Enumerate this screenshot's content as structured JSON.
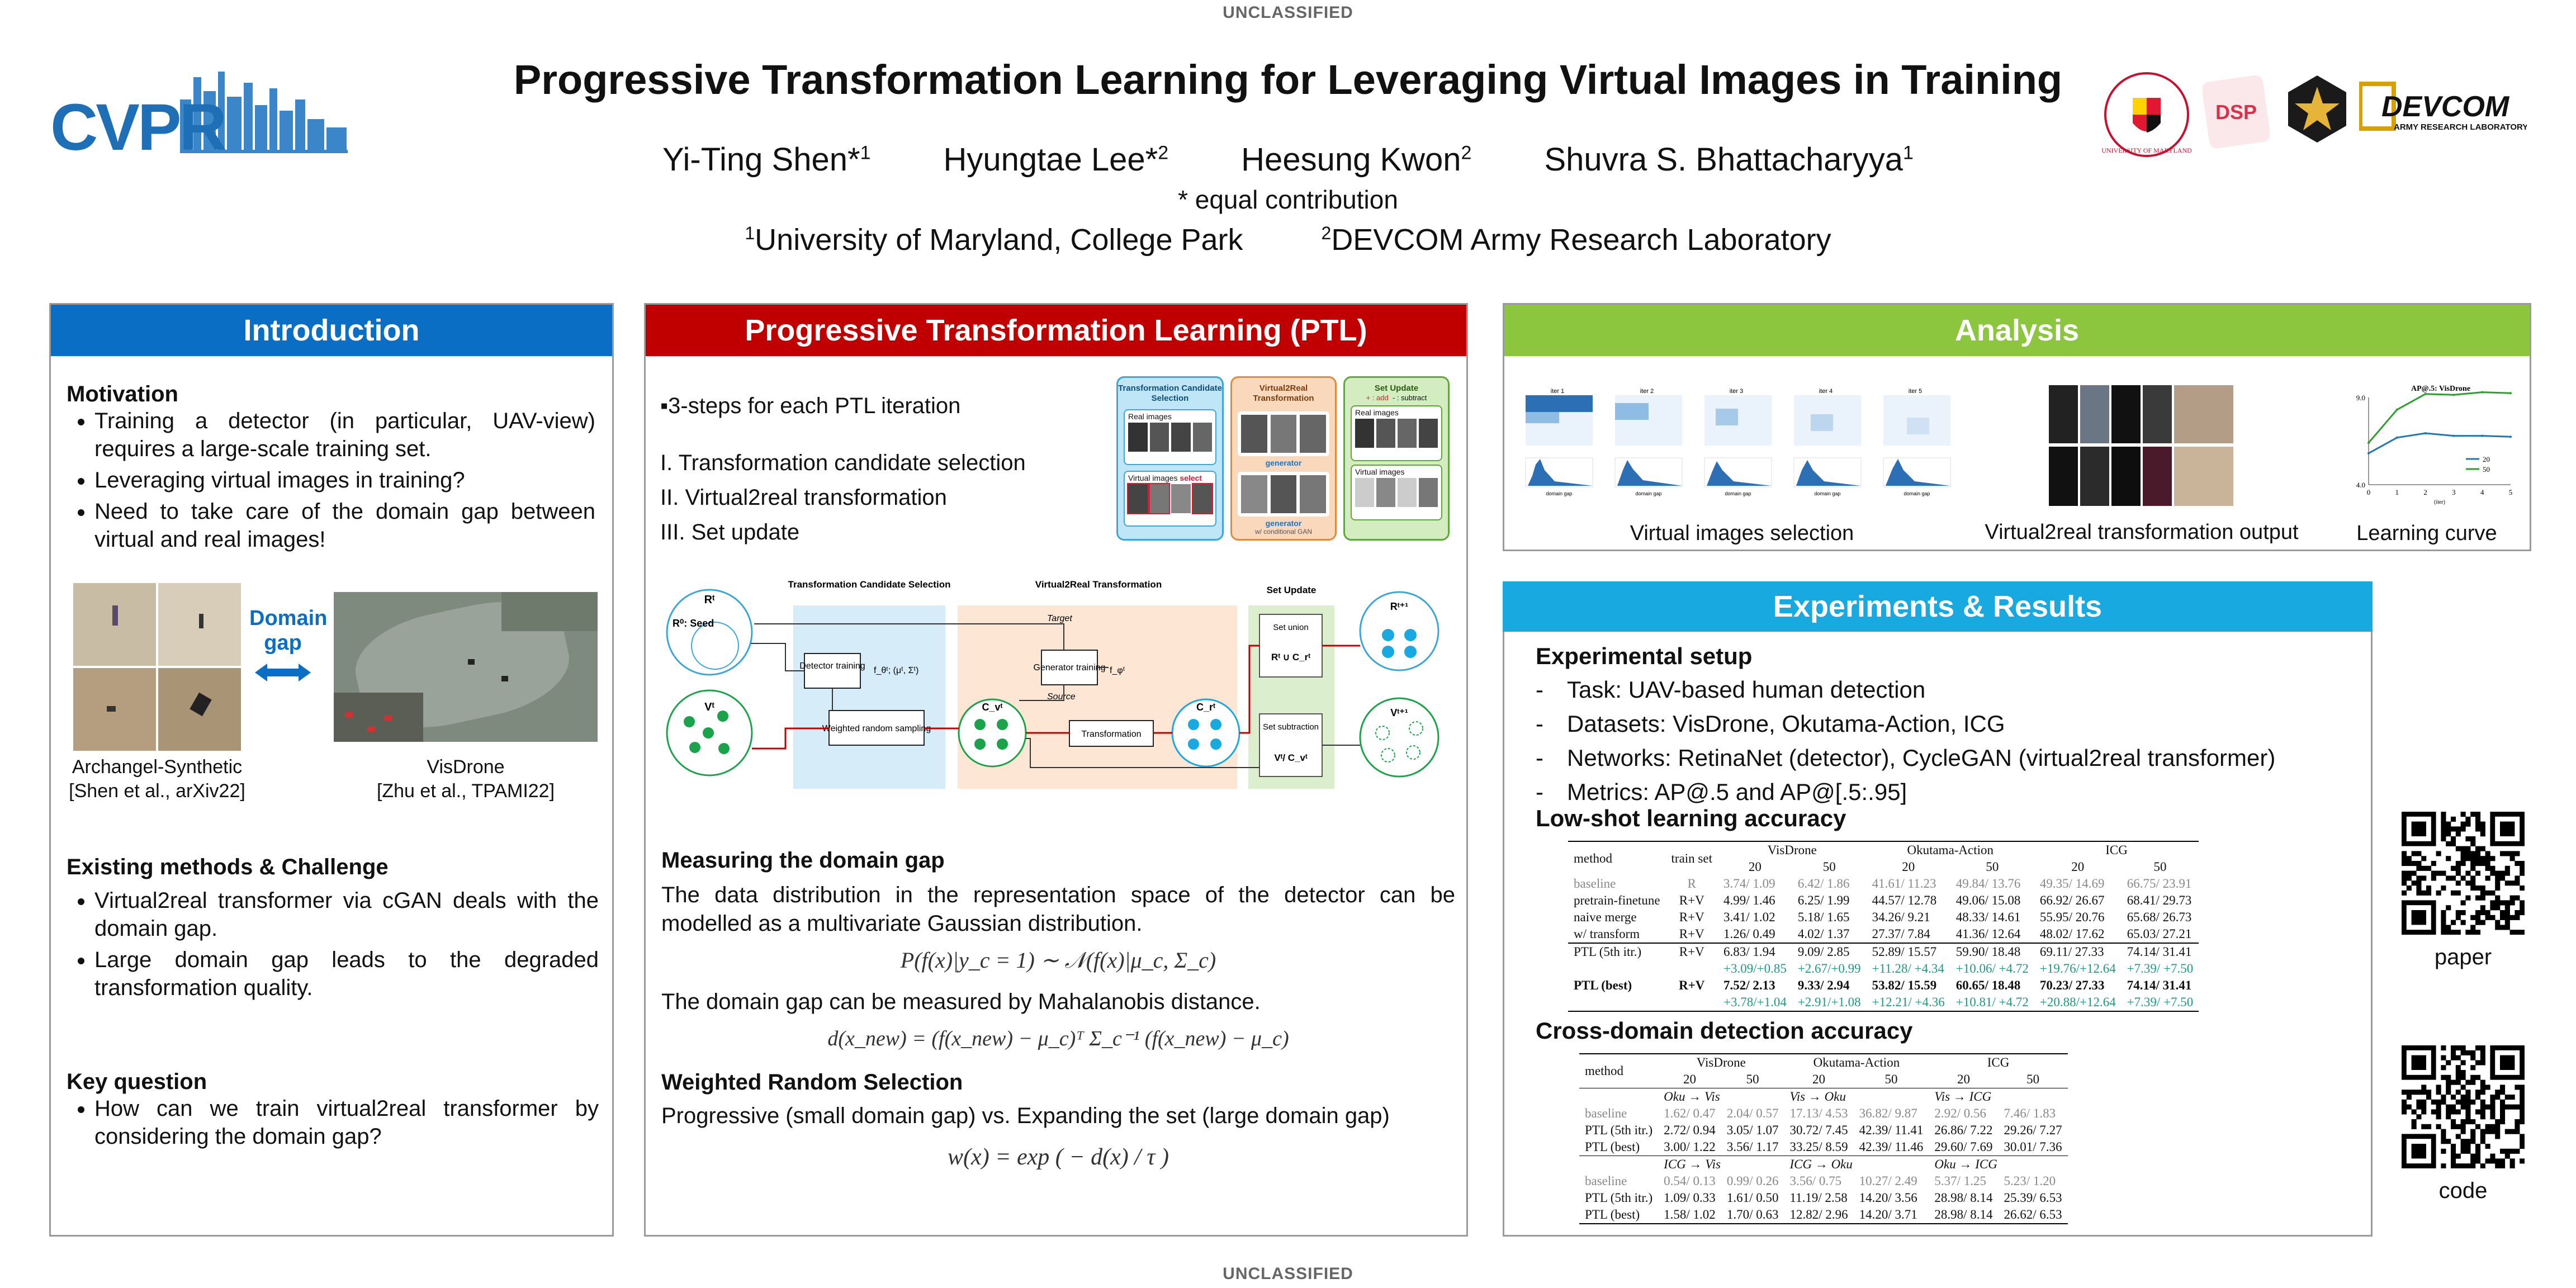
{
  "classification": "UNCLASSIFIED",
  "logos": {
    "cvpr": "CVPR",
    "umd": "UNIVERSITY OF MARYLAND",
    "devcom": "DEVCOM",
    "devcom_sub": "ARMY RESEARCH LABORATORY",
    "dsp": "DSP"
  },
  "title": "Progressive Transformation Learning for Leveraging Virtual Images in Training",
  "authors": [
    {
      "name": "Yi-Ting Shen*",
      "sup": "1"
    },
    {
      "name": "Hyungtae Lee*",
      "sup": "2"
    },
    {
      "name": "Heesung Kwon",
      "sup": "2"
    },
    {
      "name": "Shuvra S. Bhattacharyya",
      "sup": "1"
    }
  ],
  "equal_contribution": "* equal contribution",
  "affiliations": [
    {
      "sup": "1",
      "name": "University of Maryland, College Park"
    },
    {
      "sup": "2",
      "name": "DEVCOM Army Research Laboratory"
    }
  ],
  "colors": {
    "intro": "#0b6ec5",
    "ptl": "#c00000",
    "analysis": "#8cc63f",
    "experiments": "#17a9e0",
    "teal": "#1a9a86"
  },
  "intro": {
    "header": "Introduction",
    "motivation_title": "Motivation",
    "motivation": [
      "Training a detector (in particular, UAV-view) requires a large-scale training set.",
      "Leveraging virtual images in training?",
      "Need to take care of the domain gap between virtual and real images!"
    ],
    "domain_gap": "Domain gap",
    "left_caption_1": "Archangel-Synthetic",
    "left_caption_2": "[Shen et al., arXiv22]",
    "right_caption_1": "VisDrone",
    "right_caption_2": "[Zhu et al., TPAMI22]",
    "existing_title": "Existing methods & Challenge",
    "existing": [
      "Virtual2real transformer via cGAN deals with the domain gap.",
      "Large domain gap leads to the degraded transformation quality."
    ],
    "key_title": "Key question",
    "key": [
      "How can we train virtual2real transformer by considering the domain gap?"
    ]
  },
  "ptl": {
    "header": "Progressive Transformation Learning (PTL)",
    "steps_intro": "▪3-steps for each PTL iteration",
    "steps": [
      "I. Transformation candidate selection",
      "II. Virtual2real transformation",
      "III. Set update"
    ],
    "mini": {
      "col1": "Transformation Candidate Selection",
      "col2": "Virtual2Real Transformation",
      "col3": "Set Update",
      "real_images": "Real images",
      "virtual_images": "Virtual images",
      "select": "select",
      "generator": "generator",
      "cgan": "w/ conditional GAN",
      "add": "+ : add",
      "subtract": "- : subtract"
    },
    "diagram": {
      "stage1": "Transformation Candidate Selection",
      "stage2": "Virtual2Real Transformation",
      "stage3": "Set Update",
      "r_t": "Rᵗ",
      "r_0": "R⁰: Seed",
      "v_t": "Vᵗ",
      "detector_training": "Detector training",
      "f_theta": "f_θᵗ; (μᵗ, Σᵗ)",
      "weighted_sampling": "Weighted random sampling",
      "c_v": "C_vᵗ",
      "target": "Target",
      "source": "Source",
      "generator_training": "Generator training",
      "f_phi": "f_φᵗ",
      "transformation": "Transformation",
      "c_r": "C_rᵗ",
      "set_union": "Set union",
      "union_expr": "Rᵗ ∪ C_rᵗ",
      "set_subtraction": "Set subtraction",
      "sub_expr": "Vᵗ/ C_vᵗ",
      "r_next": "Rᵗ⁺¹",
      "v_next": "Vᵗ⁺¹"
    },
    "measure_title": "Measuring the domain gap",
    "measure_text": "The data distribution in the representation space of the detector can be modelled as a multivariate Gaussian distribution.",
    "eq1": "P(f(x)|y_c = 1) ∼ 𝒩(f(x)|μ_c, Σ_c)",
    "mahal_text": "The domain gap can be measured by Mahalanobis distance.",
    "eq2": "d(x_new) = (f(x_new) − μ_c)ᵀ Σ_c⁻¹ (f(x_new) − μ_c)",
    "wrs_title": "Weighted Random Selection",
    "wrs_text": "Progressive (small domain gap) vs. Expanding the set (large domain gap)",
    "eq3": "w(x) = exp ( − d(x) / τ )"
  },
  "analysis": {
    "header": "Analysis",
    "cap1": "Virtual images selection",
    "cap2": "Virtual2real transformation output",
    "cap3": "Learning curve",
    "iters": [
      "iter 1",
      "iter 2",
      "iter 3",
      "iter 4",
      "iter 5"
    ],
    "hist_xlabel": "domain gap",
    "curve_title": "AP@.5: VisDrone",
    "curve_xlabel": "(iter)",
    "curve_legend": [
      "20",
      "50"
    ]
  },
  "curve_chart": {
    "type": "line",
    "x": [
      0,
      1,
      2,
      3,
      4,
      5
    ],
    "ylim": [
      4.0,
      9.0
    ],
    "yticks": [
      "9.0",
      "4.0"
    ],
    "xticks": [
      "0",
      "1",
      "2",
      "3",
      "4",
      "5"
    ],
    "series": [
      {
        "name": "20",
        "values": [
          5.8,
          6.7,
          6.95,
          6.8,
          6.8,
          6.75
        ]
      },
      {
        "name": "50",
        "values": [
          6.4,
          8.3,
          9.2,
          9.15,
          9.3,
          9.25
        ]
      }
    ]
  },
  "experiments": {
    "header": "Experiments & Results",
    "setup_title": "Experimental setup",
    "setup": [
      "Task: UAV-based human detection",
      "Datasets: VisDrone, Okutama-Action, ICG",
      "Networks: RetinaNet (detector), CycleGAN (virtual2real transformer)",
      "Metrics: AP@.5 and AP@[.5:.95]"
    ],
    "lowshot_title": "Low-shot learning accuracy",
    "cross_title": "Cross-domain detection accuracy"
  },
  "lowshot_table": {
    "headers": [
      "method",
      "train set",
      "VisDrone",
      "Okutama-Action",
      "ICG"
    ],
    "sub": [
      "20",
      "50",
      "20",
      "50",
      "20",
      "50"
    ],
    "rows": [
      {
        "style": "gray",
        "cells": [
          "baseline",
          "R",
          "3.74/ 1.09",
          "6.42/ 1.86",
          "41.61/ 11.23",
          "49.84/ 13.76",
          "49.35/ 14.69",
          "66.75/ 23.91"
        ]
      },
      {
        "style": "",
        "cells": [
          "pretrain-finetune",
          "R+V",
          "4.99/ 1.46",
          "6.25/ 1.99",
          "44.57/ 12.78",
          "49.06/ 15.08",
          "66.92/ 26.67",
          "68.41/ 29.73"
        ]
      },
      {
        "style": "",
        "cells": [
          "naive merge",
          "R+V",
          "3.41/ 1.02",
          "5.18/ 1.65",
          "34.26/ 9.21",
          "48.33/ 14.61",
          "55.95/ 20.76",
          "65.68/ 26.73"
        ]
      },
      {
        "style": "",
        "cells": [
          "w/ transform",
          "R+V",
          "1.26/ 0.49",
          "4.02/ 1.37",
          "27.37/ 7.84",
          "41.36/ 12.64",
          "48.02/ 17.62",
          "65.03/ 27.21"
        ]
      },
      {
        "style": "topline",
        "cells": [
          "PTL (5th itr.)",
          "R+V",
          "6.83/ 1.94",
          "9.09/ 2.85",
          "52.89/ 15.57",
          "59.90/ 18.48",
          "69.11/ 27.33",
          "74.14/ 31.41"
        ]
      },
      {
        "style": "teal",
        "cells": [
          "",
          "",
          "+3.09/+0.85",
          "+2.67/+0.99",
          "+11.28/ +4.34",
          "+10.06/ +4.72",
          "+19.76/+12.64",
          "+7.39/ +7.50"
        ]
      },
      {
        "style": "b",
        "cells": [
          "PTL (best)",
          "R+V",
          "7.52/ 2.13",
          "9.33/ 2.94",
          "53.82/ 15.59",
          "60.65/ 18.48",
          "70.23/ 27.33",
          "74.14/ 31.41"
        ]
      },
      {
        "style": "teal botline",
        "cells": [
          "",
          "",
          "+3.78/+1.04",
          "+2.91/+1.08",
          "+12.21/ +4.36",
          "+10.81/ +4.72",
          "+20.88/+12.64",
          "+7.39/ +7.50"
        ]
      }
    ]
  },
  "cross_table": {
    "headers": [
      "method",
      "VisDrone",
      "Okutama-Action",
      "ICG"
    ],
    "sub": [
      "20",
      "50",
      "20",
      "50",
      "20",
      "50"
    ],
    "blocks": [
      {
        "labels": [
          "Oku → Vis",
          "Vis → Oku",
          "Vis → ICG"
        ],
        "rows": [
          {
            "style": "gray",
            "cells": [
              "baseline",
              "1.62/ 0.47",
              "2.04/ 0.57",
              "17.13/ 4.53",
              "36.82/ 9.87",
              "2.92/ 0.56",
              "7.46/ 1.83"
            ]
          },
          {
            "style": "",
            "cells": [
              "PTL (5th itr.)",
              "2.72/ 0.94",
              "3.05/ 1.07",
              "30.72/ 7.45",
              "42.39/ 11.41",
              "26.86/ 7.22",
              "29.26/ 7.27"
            ]
          },
          {
            "style": "",
            "cells": [
              "PTL (best)",
              "3.00/ 1.22",
              "3.56/ 1.17",
              "33.25/ 8.59",
              "42.39/ 11.46",
              "29.60/ 7.69",
              "30.01/ 7.36"
            ]
          }
        ]
      },
      {
        "labels": [
          "ICG → Vis",
          "ICG → Oku",
          "Oku → ICG"
        ],
        "rows": [
          {
            "style": "gray",
            "cells": [
              "baseline",
              "0.54/ 0.13",
              "0.99/ 0.26",
              "3.56/ 0.75",
              "10.27/ 2.49",
              "5.37/ 1.25",
              "5.23/ 1.20"
            ]
          },
          {
            "style": "",
            "cells": [
              "PTL (5th itr.)",
              "1.09/ 0.33",
              "1.61/ 0.50",
              "11.19/ 2.58",
              "14.20/ 3.56",
              "28.98/ 8.14",
              "25.39/ 6.53"
            ]
          },
          {
            "style": "",
            "cells": [
              "PTL (best)",
              "1.58/ 1.02",
              "1.70/ 0.63",
              "12.82/ 2.96",
              "14.20/ 3.71",
              "28.98/ 8.14",
              "26.62/ 6.53"
            ]
          }
        ]
      }
    ]
  },
  "qr": {
    "paper_label": "paper",
    "code_label": "code"
  }
}
